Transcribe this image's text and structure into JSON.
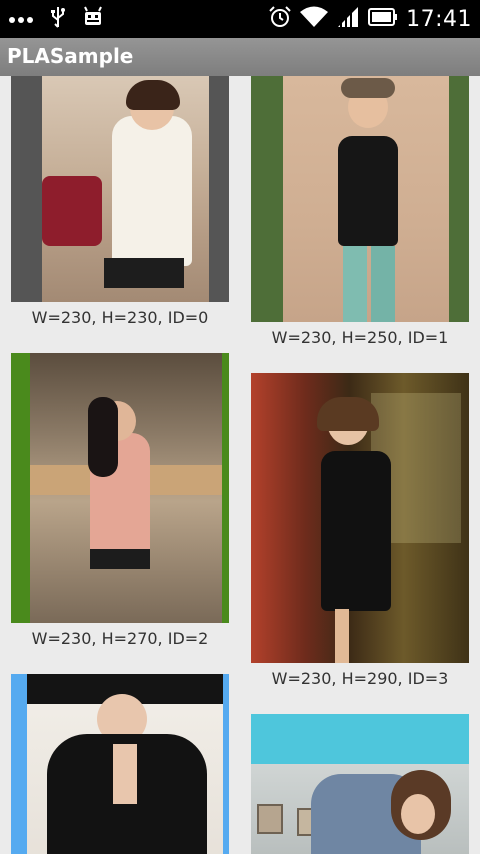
{
  "status_bar": {
    "time": "17:41",
    "icons": [
      "more-dots-icon",
      "usb-icon",
      "android-debug-icon",
      "alarm-icon",
      "wifi-icon",
      "signal-icon",
      "battery-icon"
    ]
  },
  "action_bar": {
    "title": "PLASample"
  },
  "colors": {
    "status_bar": "#000000",
    "action_bar": "#888888",
    "background": "#ebebeb",
    "frame_gray": "#555555",
    "frame_olive": "#4e6e38",
    "frame_green": "#4a8a1c",
    "frame_blue": "#55aaf0",
    "frame_cyan": "#4ec6dc"
  },
  "items": [
    {
      "caption": "W=230, H=230, ID=0",
      "frame_color": "#555555"
    },
    {
      "caption": "W=230, H=250, ID=1",
      "frame_color": "#4e6e38"
    },
    {
      "caption": "W=230, H=270, ID=2",
      "frame_color": "#4a8a1c"
    },
    {
      "caption": "W=230, H=290, ID=3",
      "frame_color": "#7a1a1a"
    },
    {
      "caption": "",
      "frame_color": "#55aaf0"
    },
    {
      "caption": "",
      "frame_color": "#4ec6dc"
    }
  ]
}
